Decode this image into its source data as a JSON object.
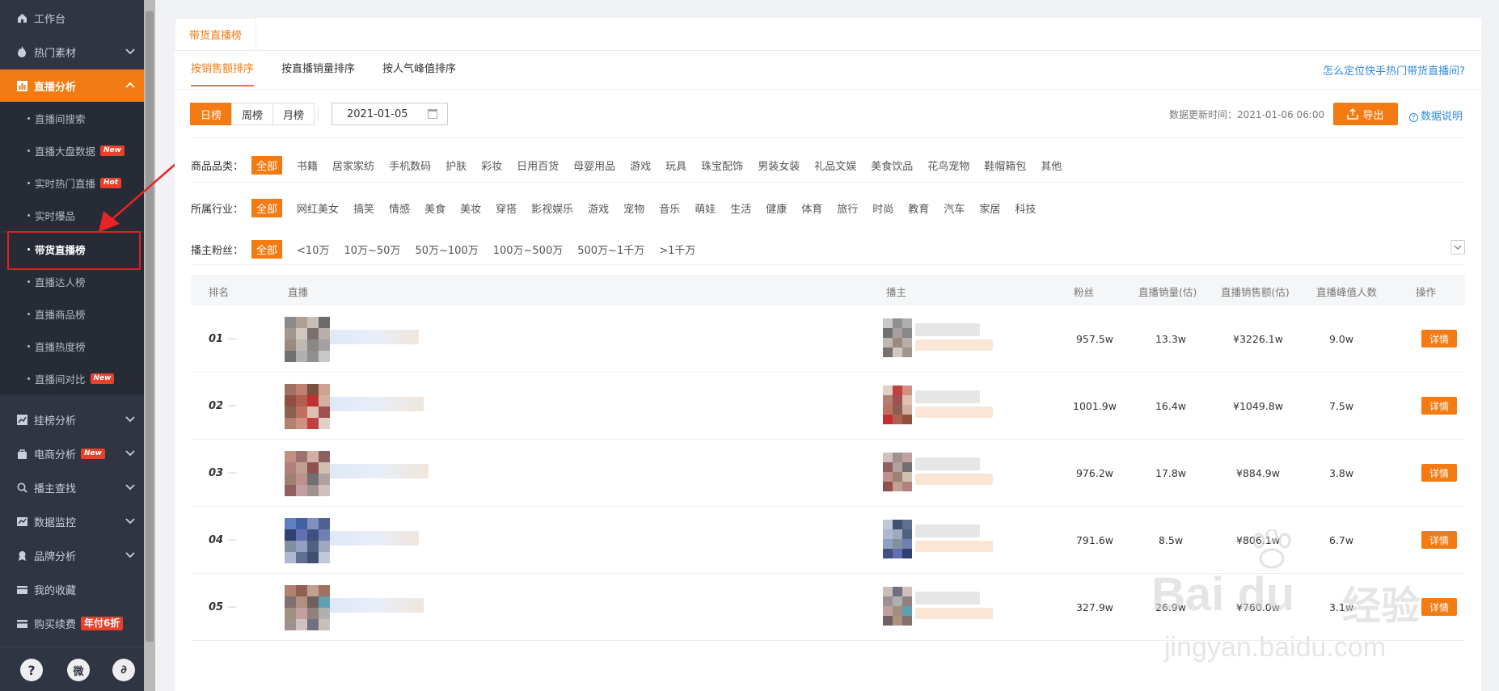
{
  "sidebar": {
    "items": [
      {
        "label": "工作台",
        "icon": "home-icon"
      },
      {
        "label": "热门素材",
        "icon": "flame-icon"
      },
      {
        "label": "直播分析",
        "icon": "bar-chart-icon"
      },
      {
        "label": "挂榜分析",
        "icon": "trend-icon"
      },
      {
        "label": "电商分析",
        "icon": "bag-icon",
        "badge": "New"
      },
      {
        "label": "播主查找",
        "icon": "search-icon"
      },
      {
        "label": "数据监控",
        "icon": "monitor-icon"
      },
      {
        "label": "品牌分析",
        "icon": "brand-icon"
      },
      {
        "label": "我的收藏",
        "icon": "collect-icon"
      },
      {
        "label": "购买续费",
        "icon": "card-icon",
        "badge": "年付6折"
      }
    ],
    "subitems": [
      {
        "label": "直播间搜索"
      },
      {
        "label": "直播大盘数据",
        "badge": "New"
      },
      {
        "label": "实时热门直播",
        "badge": "Hot"
      },
      {
        "label": "实时爆品"
      },
      {
        "label": "带货直播榜"
      },
      {
        "label": "直播达人榜"
      },
      {
        "label": "直播商品榜"
      },
      {
        "label": "直播热度榜"
      },
      {
        "label": "直播间对比",
        "badge": "New"
      }
    ],
    "bottom": [
      "?",
      "微",
      "∂"
    ]
  },
  "main": {
    "top_tab": "带货直播榜",
    "sort_tabs": [
      "按销售额排序",
      "按直播销量排序",
      "按人气峰值排序"
    ],
    "help_link": "怎么定位快手热门带货直播间?",
    "periods": [
      "日榜",
      "周榜",
      "月榜"
    ],
    "date": "2021-01-05",
    "update_time": "数据更新时间：2021-01-06 06:00",
    "export_label": "导出",
    "data_help": "数据说明",
    "filters": {
      "category": {
        "label": "商品品类：",
        "options": [
          "全部",
          "书籍",
          "居家家纺",
          "手机数码",
          "护肤",
          "彩妆",
          "日用百货",
          "母婴用品",
          "游戏",
          "玩具",
          "珠宝配饰",
          "男装女装",
          "礼品文娱",
          "美食饮品",
          "花鸟宠物",
          "鞋帽箱包",
          "其他"
        ]
      },
      "industry": {
        "label": "所属行业：",
        "options": [
          "全部",
          "网红美女",
          "搞笑",
          "情感",
          "美食",
          "美妆",
          "穿搭",
          "影视娱乐",
          "游戏",
          "宠物",
          "音乐",
          "萌娃",
          "生活",
          "健康",
          "体育",
          "旅行",
          "时尚",
          "教育",
          "汽车",
          "家居",
          "科技"
        ]
      },
      "fans": {
        "label": "播主粉丝：",
        "options": [
          "全部",
          "<10万",
          "10万~50万",
          "50万~100万",
          "100万~500万",
          "500万~1千万",
          ">1千万"
        ]
      }
    },
    "table": {
      "headers": [
        "排名",
        "直播",
        "播主",
        "粉丝",
        "直播销量(估)",
        "直播销售额(估)",
        "直播峰值人数",
        "操作"
      ],
      "rows": [
        {
          "rank": "01",
          "fans": "957.5w",
          "sales": "13.3w",
          "revenue": "¥3226.1w",
          "peak": "9.0w",
          "action": "详情"
        },
        {
          "rank": "02",
          "fans": "1001.9w",
          "sales": "16.4w",
          "revenue": "¥1049.8w",
          "peak": "7.5w",
          "action": "详情"
        },
        {
          "rank": "03",
          "fans": "976.2w",
          "sales": "17.8w",
          "revenue": "¥884.9w",
          "peak": "3.8w",
          "action": "详情"
        },
        {
          "rank": "04",
          "fans": "791.6w",
          "sales": "8.5w",
          "revenue": "¥806.1w",
          "peak": "6.7w",
          "action": "详情"
        },
        {
          "rank": "05",
          "fans": "327.9w",
          "sales": "26.9w",
          "revenue": "¥760.0w",
          "peak": "3.1w",
          "action": "详情"
        }
      ]
    }
  },
  "watermark": {
    "logo": "Bai du",
    "cn": "经验",
    "url": "jingyan.baidu.com"
  }
}
